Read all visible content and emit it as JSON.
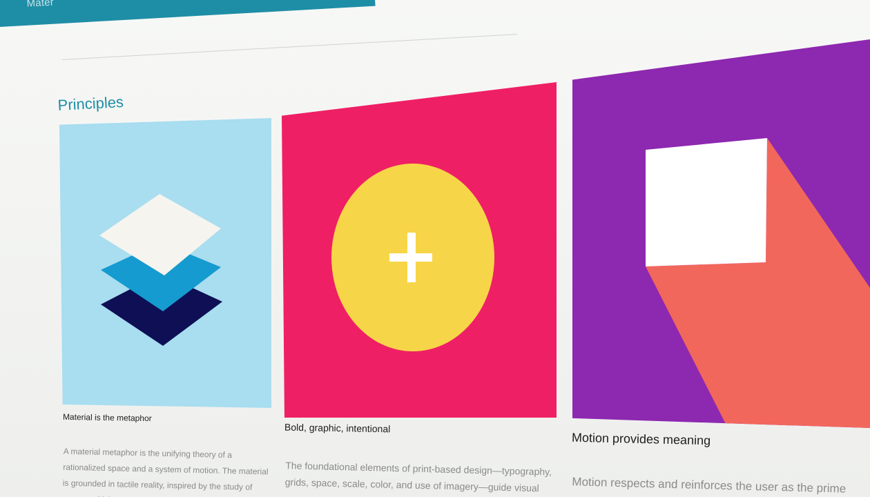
{
  "appbar": {
    "title": "Mater"
  },
  "section": {
    "title": "Principles"
  },
  "cards": [
    {
      "title": "Material is the metaphor",
      "body": "A material metaphor is the unifying theory of a rationalized space and a system of motion. The material is grounded in tactile reality, inspired by the study of paper and ink yet",
      "colors": {
        "background": "#a9ddf0",
        "layer_top": "#f5f4ee",
        "layer_mid": "#159bd0",
        "layer_bottom": "#0e0f55"
      }
    },
    {
      "title": "Bold, graphic, intentional",
      "body": "The foundational elements of print-based design—typography, grids, space, scale, color, and use of imagery—guide visual",
      "colors": {
        "background": "#ef1f65",
        "circle": "#f7d548",
        "plus": "#ffffff"
      }
    },
    {
      "title": "Motion provides meaning",
      "body": "Motion respects and reinforces the user as the prime mover",
      "colors": {
        "background": "#8d28b0",
        "square": "#ffffff",
        "shadow": "#f2675c"
      }
    }
  ],
  "icons": {
    "card1": "stacked-layers-icon",
    "card2": "add-circle-icon",
    "card3": "square-shadow-icon"
  }
}
